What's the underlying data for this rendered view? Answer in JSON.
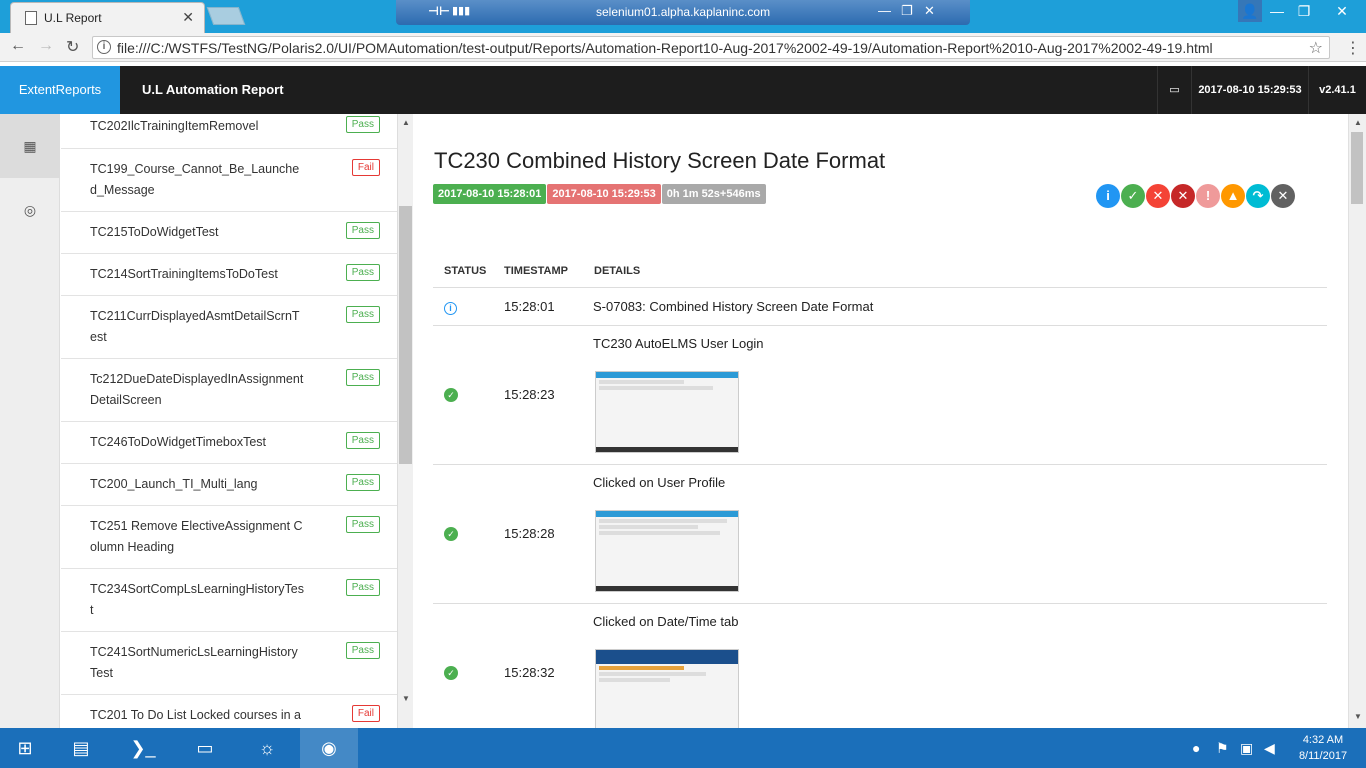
{
  "browser": {
    "tab_title": "U.L Report",
    "tab_close": "✕",
    "rdp_title": "selenium01.alpha.kaplaninc.com",
    "url": "file:///C:/WSTFS/TestNG/Polaris2.0/UI/POMAutomation/test-output/Reports/Automation-Report10-Aug-2017%2002-49-19/Automation-Report%2010-Aug-2017%2002-49-19.html"
  },
  "report": {
    "brand": "ExtentReports",
    "title": "U.L Automation Report",
    "timestamp": "2017-08-10 15:29:53",
    "version": "v2.41.1"
  },
  "tests": [
    {
      "name": "TC202IlcTrainingItemRemovel",
      "status": "Pass"
    },
    {
      "name": "TC199_Course_Cannot_Be_Launched_Message",
      "status": "Fail"
    },
    {
      "name": "TC215ToDoWidgetTest",
      "status": "Pass"
    },
    {
      "name": "TC214SortTrainingItemsToDoTest",
      "status": "Pass"
    },
    {
      "name": "TC211CurrDisplayedAsmtDetailScrnTest",
      "status": "Pass"
    },
    {
      "name": "Tc212DueDateDisplayedInAssignmentDetailScreen",
      "status": "Pass"
    },
    {
      "name": "TC246ToDoWidgetTimeboxTest",
      "status": "Pass"
    },
    {
      "name": "TC200_Launch_TI_Multi_lang",
      "status": "Pass"
    },
    {
      "name": "TC251 Remove ElectiveAssignment Column Heading",
      "status": "Pass"
    },
    {
      "name": "TC234SortCompLsLearningHistoryTest",
      "status": "Pass"
    },
    {
      "name": "TC241SortNumericLsLearningHistoryTest",
      "status": "Pass"
    },
    {
      "name": "TC201 To Do List Locked courses in a",
      "status": "Fail"
    }
  ],
  "detail": {
    "title": "TC230 Combined History Screen Date Format",
    "start_time": "2017-08-10 15:28:01",
    "end_time": "2017-08-10 15:29:53",
    "duration": "0h 1m 52s+546ms",
    "headers": {
      "status": "STATUS",
      "timestamp": "TIMESTAMP",
      "details": "DETAILS"
    },
    "logs": [
      {
        "status": "info",
        "time": "15:28:01",
        "detail": "S-07083: Combined History Screen Date Format"
      },
      {
        "status": "pass",
        "time": "15:28:23",
        "detail": "TC230 AutoELMS User Login"
      },
      {
        "status": "pass",
        "time": "15:28:28",
        "detail": "Clicked on User Profile"
      },
      {
        "status": "pass",
        "time": "15:28:32",
        "detail": "Clicked on Date/Time tab"
      }
    ]
  },
  "colors": {
    "brand_blue": "#2196e0",
    "pass_green": "#4caf50",
    "fail_red": "#e53935",
    "header_dark": "#1d1d1d",
    "taskbar": "#1b6fba"
  },
  "taskbar": {
    "time": "4:32 AM",
    "date": "8/11/2017"
  }
}
